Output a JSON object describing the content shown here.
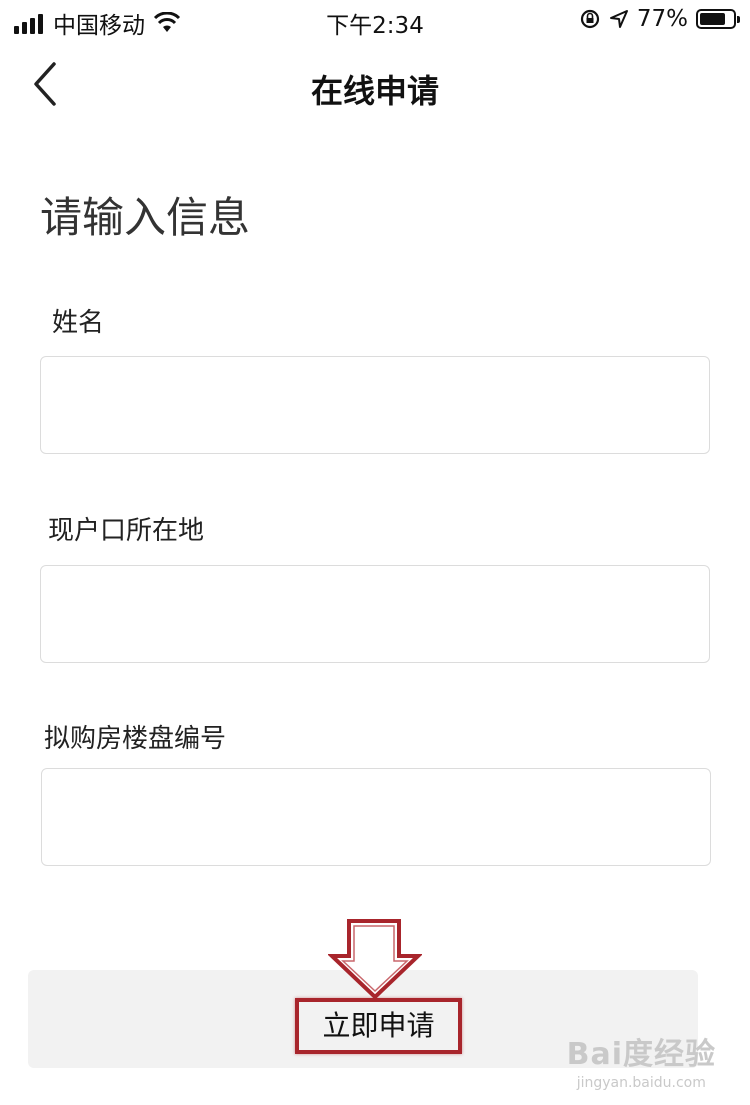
{
  "status_bar": {
    "carrier": "中国移动",
    "time": "下午2:34",
    "battery": "77%",
    "battery_level": 0.77,
    "icons": [
      "signal-icon",
      "wifi-icon",
      "rotation-lock-icon",
      "location-icon",
      "battery-icon"
    ]
  },
  "nav": {
    "back_icon": "chevron-left-icon",
    "title": "在线申请"
  },
  "form": {
    "heading": "请输入信息",
    "fields": [
      {
        "label": "姓名",
        "value": ""
      },
      {
        "label": "现户口所在地",
        "value": ""
      },
      {
        "label": "拟购房楼盘编号",
        "value": ""
      }
    ],
    "submit_label": "立即申请"
  },
  "annotation": {
    "arrow_icon": "down-arrow-icon",
    "highlight_color": "#a8252c"
  },
  "watermark": {
    "text": "Bai度经验",
    "url_text": "jingyan.baidu.com"
  }
}
